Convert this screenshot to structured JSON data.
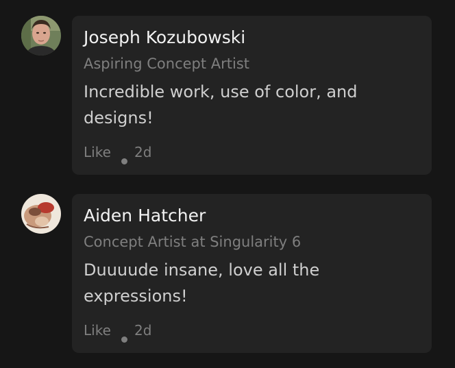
{
  "comments": [
    {
      "author": "Joseph Kozubowski",
      "headline": "Aspiring Concept Artist",
      "text": "Incredible work, use of color, and designs!",
      "like_label": "Like",
      "time": "2d",
      "avatar_icon": "profile-photo"
    },
    {
      "author": "Aiden Hatcher",
      "headline": "Concept Artist at Singularity 6",
      "text": "Duuuude insane, love all the expressions!",
      "like_label": "Like",
      "time": "2d",
      "avatar_icon": "profile-photo"
    }
  ],
  "colors": {
    "background": "#161616",
    "card": "#232323",
    "name": "#f2f2f2",
    "muted": "#7f7f7f",
    "body_text": "#cfcfcf"
  }
}
